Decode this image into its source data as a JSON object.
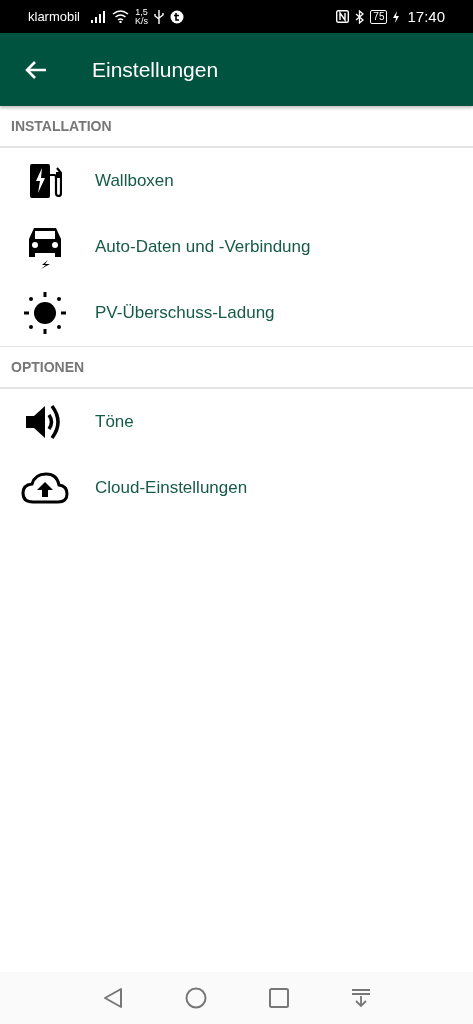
{
  "status_bar": {
    "carrier": "klarmobil",
    "speed_value": "1,5",
    "speed_unit": "K/s",
    "battery": "75",
    "time": "17:40"
  },
  "app_bar": {
    "title": "Einstellungen"
  },
  "sections": [
    {
      "title": "INSTALLATION",
      "items": [
        {
          "label": "Wallboxen"
        },
        {
          "label": "Auto-Daten und -Verbindung"
        },
        {
          "label": "PV-Überschuss-Ladung"
        }
      ]
    },
    {
      "title": "OPTIONEN",
      "items": [
        {
          "label": "Töne"
        },
        {
          "label": "Cloud-Einstellungen"
        }
      ]
    }
  ]
}
